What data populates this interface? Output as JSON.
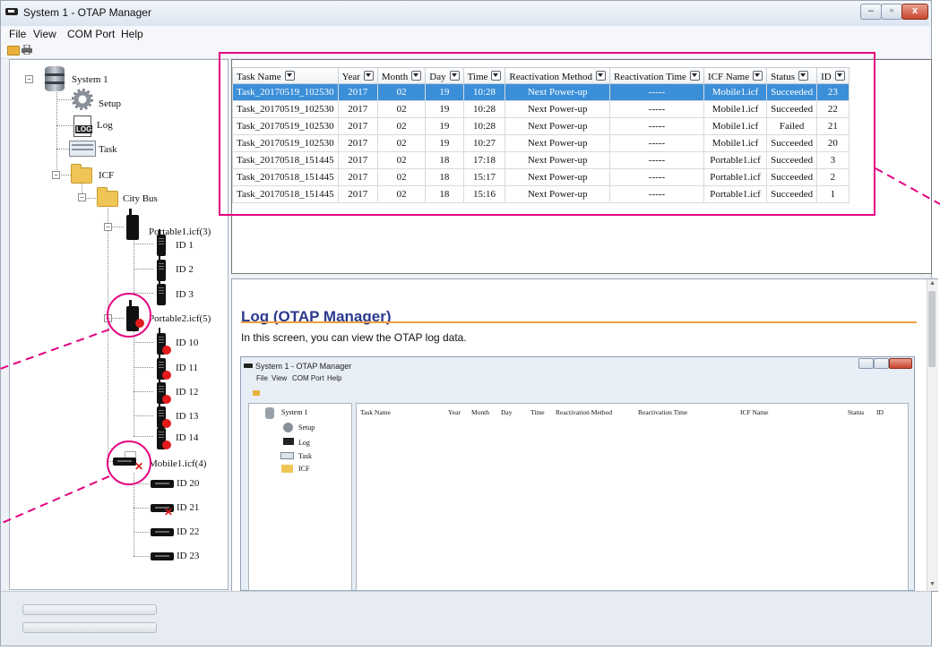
{
  "window": {
    "title": "System 1 - OTAP Manager"
  },
  "menu": {
    "file": "File",
    "view": "View",
    "com_port": "COM Port",
    "help": "Help"
  },
  "tree": {
    "root": "System 1",
    "setup": "Setup",
    "log": "Log",
    "task": "Task",
    "icf": "ICF",
    "group": "City Bus",
    "portable1": "Portable1.icf(3)",
    "portable1_ids": [
      "ID 1",
      "ID 2",
      "ID 3"
    ],
    "portable2": "Portable2.icf(5)",
    "portable2_ids": [
      "ID 10",
      "ID 11",
      "ID 12",
      "ID 13",
      "ID 14"
    ],
    "mobile1": "Mobile1.icf(4)",
    "mobile1_ids": [
      "ID 20",
      "ID 21",
      "ID 22",
      "ID 23"
    ],
    "log_icon_text": "LOG"
  },
  "table": {
    "columns": [
      "Task Name",
      "Year",
      "Month",
      "Day",
      "Time",
      "Reactivation Method",
      "Reactivation Time",
      "ICF Name",
      "Status",
      "ID"
    ],
    "rows": [
      [
        "Task_20170519_102530",
        "2017",
        "02",
        "19",
        "10:28",
        "Next Power-up",
        "-----",
        "Mobile1.icf",
        "Succeeded",
        "23"
      ],
      [
        "Task_20170519_102530",
        "2017",
        "02",
        "19",
        "10:28",
        "Next Power-up",
        "-----",
        "Mobile1.icf",
        "Succeeded",
        "22"
      ],
      [
        "Task_20170519_102530",
        "2017",
        "02",
        "19",
        "10:28",
        "Next Power-up",
        "-----",
        "Mobile1.icf",
        "Failed",
        "21"
      ],
      [
        "Task_20170519_102530",
        "2017",
        "02",
        "19",
        "10:27",
        "Next Power-up",
        "-----",
        "Mobile1.icf",
        "Succeeded",
        "20"
      ],
      [
        "Task_20170518_151445",
        "2017",
        "02",
        "18",
        "17:18",
        "Next Power-up",
        "-----",
        "Portable1.icf",
        "Succeeded",
        "3"
      ],
      [
        "Task_20170518_151445",
        "2017",
        "02",
        "18",
        "15:17",
        "Next Power-up",
        "-----",
        "Portable1.icf",
        "Succeeded",
        "2"
      ],
      [
        "Task_20170518_151445",
        "2017",
        "02",
        "18",
        "15:16",
        "Next Power-up",
        "-----",
        "Portable1.icf",
        "Succeeded",
        "1"
      ]
    ],
    "selected_row": 0
  },
  "help": {
    "title": "Log (OTAP Manager)",
    "description": "In this screen, you can view the OTAP log data."
  },
  "mini": {
    "title": "System 1 - OTAP Manager",
    "menu": [
      "File",
      "View",
      "COM Port",
      "Help"
    ],
    "tree": [
      "System 1",
      "Setup",
      "Log",
      "Task",
      "ICF"
    ],
    "columns": [
      "Task Name",
      "Year",
      "Month",
      "Day",
      "Time",
      "Reactivation Method",
      "Reactivation Time",
      "ICF Name",
      "Status",
      "ID"
    ]
  },
  "colors": {
    "accent_annotation": "#e4007f",
    "selection": "#3b8fd8",
    "help_title": "#2d3a8f",
    "rule": "#f0a040"
  },
  "icons": [
    "database-icon",
    "gear-icon",
    "log-icon",
    "task-icon",
    "folder-icon",
    "radio-icon",
    "mobile-radio-icon",
    "error-dot-icon",
    "error-x-icon"
  ]
}
